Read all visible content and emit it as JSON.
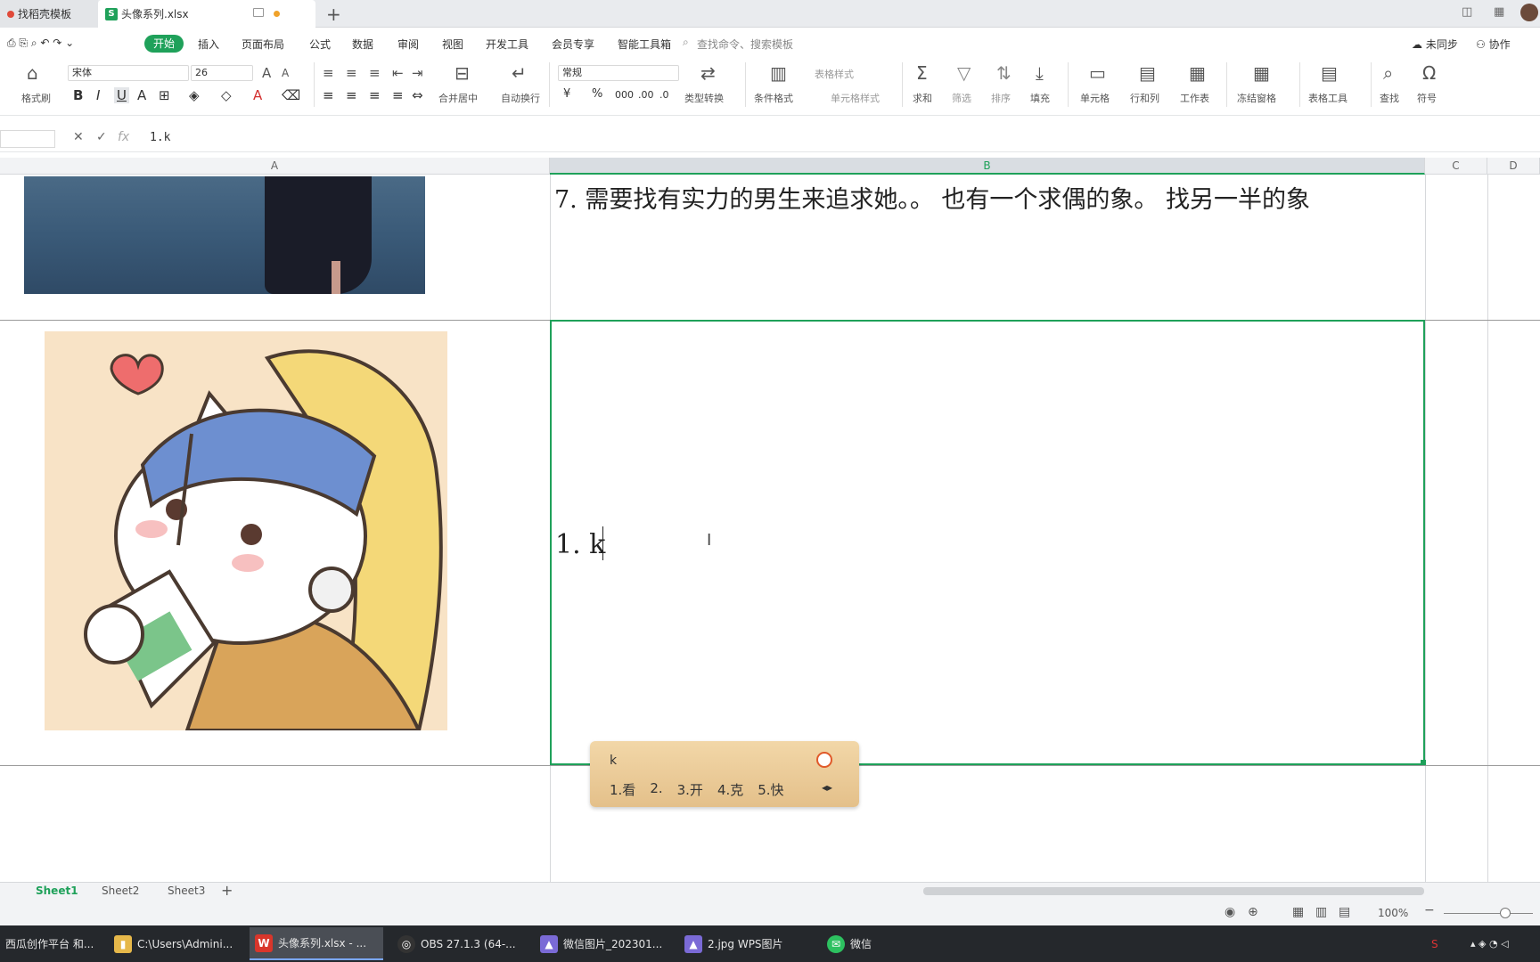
{
  "tabs": [
    {
      "label": "找稻壳模板"
    },
    {
      "label": "头像系列.xlsx"
    }
  ],
  "menu": {
    "items": [
      "开始",
      "插入",
      "页面布局",
      "公式",
      "数据",
      "审阅",
      "视图",
      "开发工具",
      "会员专享",
      "智能工具箱"
    ],
    "search_placeholder": "查找命令、搜索模板",
    "sync_status": "未同步",
    "collab": "协作"
  },
  "ribbon": {
    "format_painter": "格式刷",
    "font_name": "宋体",
    "font_size": "26",
    "merge_center": "合并居中",
    "wrap_text": "自动换行",
    "number_format": "常规",
    "type_convert": "类型转换",
    "conditional_format": "条件格式",
    "table_style": "表格样式",
    "cell_style": "单元格样式",
    "sum": "求和",
    "filter": "筛选",
    "sort": "排序",
    "fill": "填充",
    "cell": "单元格",
    "row_col": "行和列",
    "worksheet": "工作表",
    "freeze": "冻结窗格",
    "table_tools": "表格工具",
    "find": "查找",
    "symbol": "符号"
  },
  "formula": {
    "fx": "fx",
    "content": "1.k"
  },
  "columns": [
    "A",
    "B",
    "C",
    "D"
  ],
  "cells": {
    "b_top_text": "7. 需要找有实力的男生来追求她。。 也有一个求偶的象。 找另一半的象",
    "b_active_text": "1. k"
  },
  "ime": {
    "input": "k",
    "candidates": [
      "1.看",
      "2.",
      "3.开",
      "4.克",
      "5.快"
    ]
  },
  "sheets": [
    "Sheet1",
    "Sheet2",
    "Sheet3"
  ],
  "status": {
    "zoom": "100%"
  },
  "taskbar": [
    {
      "label": "西瓜创作平台 和..."
    },
    {
      "label": "C:\\Users\\Admini..."
    },
    {
      "label": "头像系列.xlsx - ..."
    },
    {
      "label": "OBS 27.1.3 (64-..."
    },
    {
      "label": "微信图片_202301..."
    },
    {
      "label": "2.jpg  WPS图片"
    },
    {
      "label": "微信"
    }
  ],
  "colors": {
    "accent": "#1fa15a",
    "ime_bg": "#e9c994"
  }
}
